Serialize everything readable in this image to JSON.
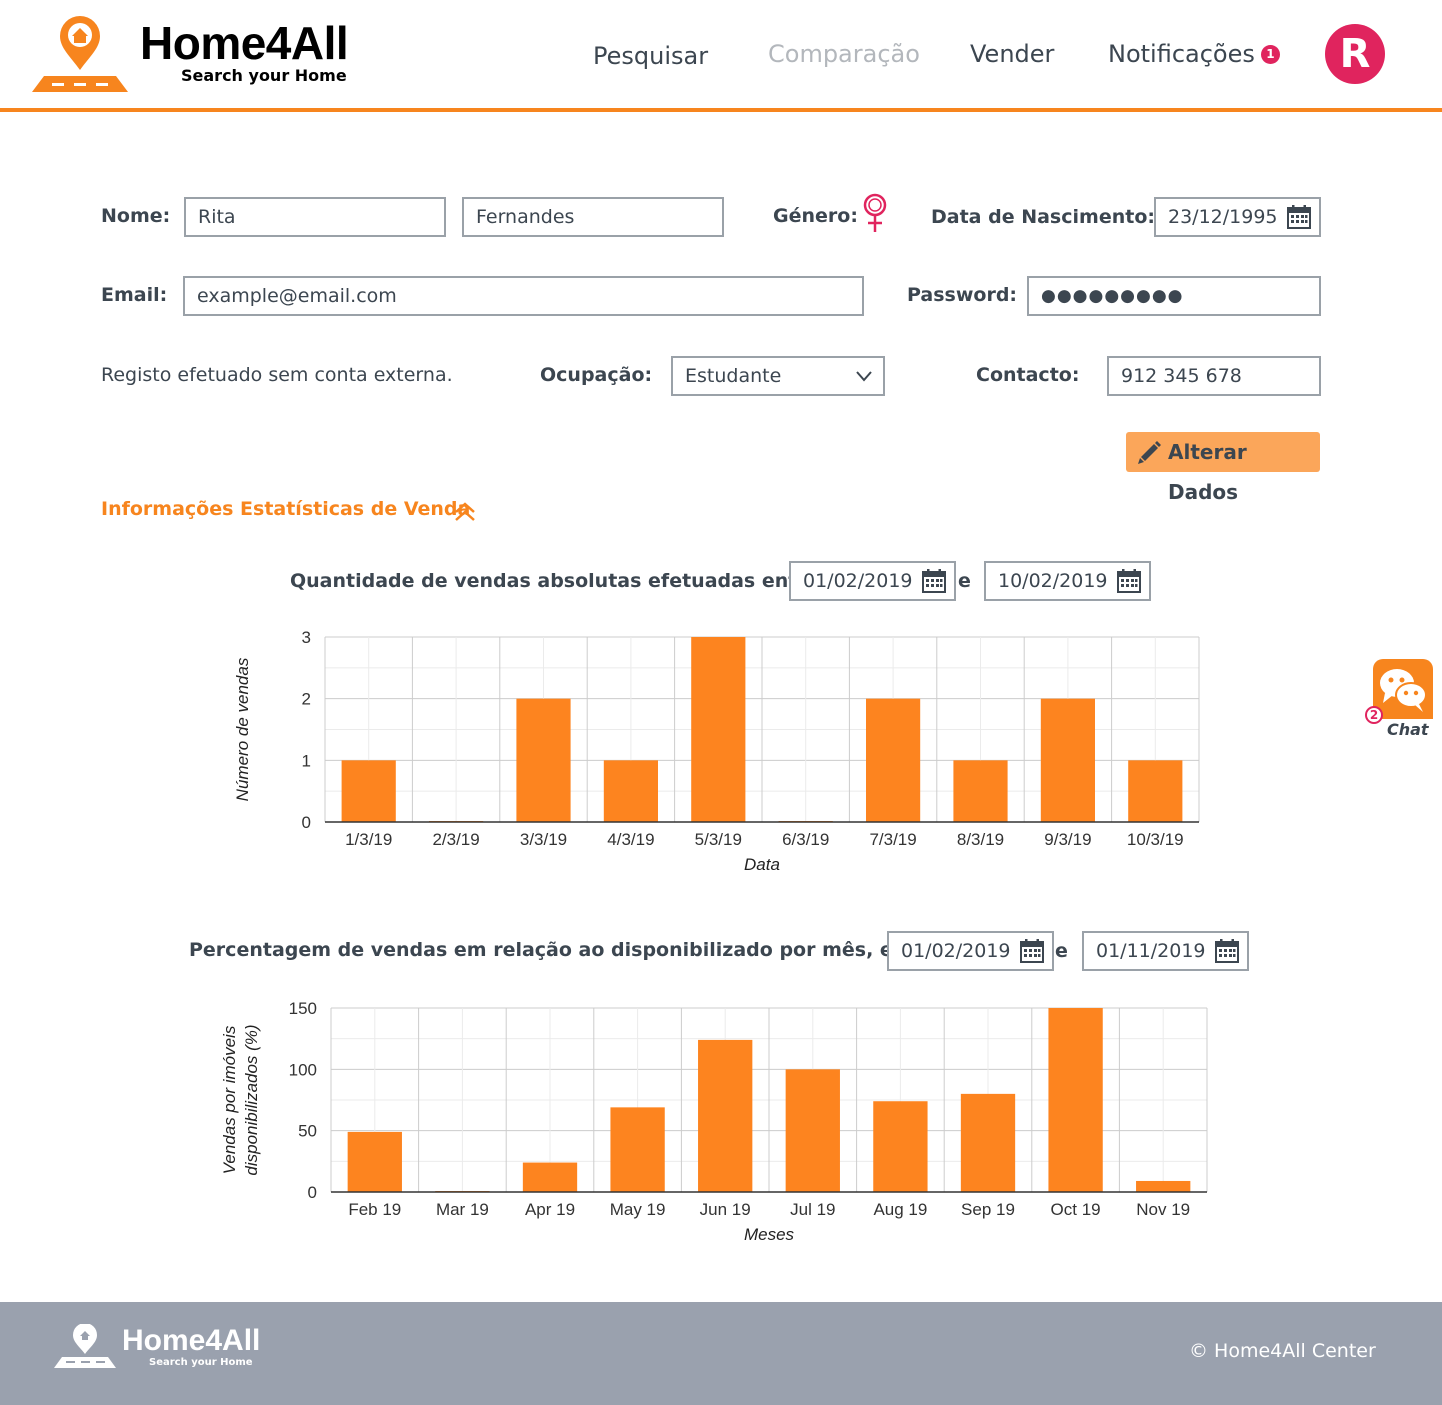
{
  "app": {
    "logo_title": "Home4All",
    "logo_subtitle": "Search your Home"
  },
  "nav": {
    "search": "Pesquisar",
    "compare": "Comparação",
    "sell": "Vender",
    "notifications": "Notificações",
    "notifications_count": "1",
    "avatar_letter": "R"
  },
  "form": {
    "name_label": "Nome:",
    "first_name": "Rita",
    "last_name": "Fernandes",
    "gender_label": "Género:",
    "gender_icon": "female-symbol-icon",
    "birth_label": "Data de Nascimento:",
    "birth_date": "23/12/1995",
    "email_label": "Email:",
    "email_value": "example@email.com",
    "password_label": "Password:",
    "password_value": "●●●●●●●●●",
    "register_note": "Registo efetuado sem conta externa.",
    "occupation_label": "Ocupação:",
    "occupation_value": "Estudante",
    "contact_label": "Contacto:",
    "contact_value": "912 345 678",
    "edit_button": "Alterar Dados"
  },
  "stats": {
    "section_title": "Informações Estatísticas de Venda",
    "chart1_title": "Quantidade de vendas absolutas efetuadas entre",
    "chart1_from": "01/02/2019",
    "chart1_to": "10/02/2019",
    "chart2_title": "Percentagem de vendas em relação ao disponibilizado por mês, entre",
    "chart2_from": "01/02/2019",
    "chart2_to": "01/11/2019",
    "separator": "e"
  },
  "chart_data": [
    {
      "type": "bar",
      "categories": [
        "1/3/19",
        "2/3/19",
        "3/3/19",
        "4/3/19",
        "5/3/19",
        "6/3/19",
        "7/3/19",
        "8/3/19",
        "9/3/19",
        "10/3/19"
      ],
      "values": [
        1,
        0,
        2,
        1,
        3,
        0,
        2,
        1,
        2,
        1
      ],
      "xlabel": "Data",
      "ylabel": "Número de vendas",
      "ylim": [
        0,
        3
      ],
      "yticks": [
        0,
        1,
        2,
        3
      ],
      "grid": true,
      "color": "#fd841f"
    },
    {
      "type": "bar",
      "categories": [
        "Feb 19",
        "Mar 19",
        "Apr 19",
        "May 19",
        "Jun 19",
        "Jul 19",
        "Aug 19",
        "Sep 19",
        "Oct 19",
        "Nov 19"
      ],
      "values": [
        49,
        0,
        24,
        69,
        124,
        100,
        74,
        80,
        150,
        9
      ],
      "xlabel": "Meses",
      "ylabel_lines": [
        "Vendas por imóveis",
        "disponibilizados (%)"
      ],
      "ylim": [
        0,
        150
      ],
      "yticks": [
        0,
        50,
        100,
        150
      ],
      "grid": true,
      "color": "#fd841f"
    }
  ],
  "chat": {
    "label": "Chat",
    "badge": "2"
  },
  "footer": {
    "logo_title": "Home4All",
    "logo_subtitle": "Search your Home",
    "copyright": "© Home4All Center"
  },
  "colors": {
    "accent": "#f7851e",
    "button": "#fba65a",
    "avatar": "#e0245e",
    "footer": "#9aa1ae"
  }
}
